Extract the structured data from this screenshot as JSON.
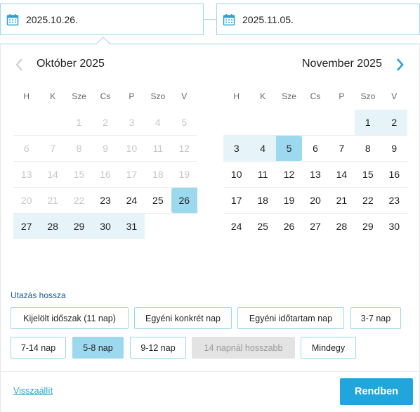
{
  "date_inputs": {
    "start": "2025.10.26.",
    "end": "2025.11.05."
  },
  "calendars": {
    "weekday_headers": [
      "H",
      "K",
      "Sze",
      "Cs",
      "P",
      "Szo",
      "V"
    ],
    "left": {
      "title": "Október 2025",
      "rows": [
        [
          "",
          "",
          "1",
          "2",
          "3",
          "4",
          "5"
        ],
        [
          "6",
          "7",
          "8",
          "9",
          "10",
          "11",
          "12"
        ],
        [
          "13",
          "14",
          "15",
          "16",
          "17",
          "18",
          "19"
        ],
        [
          "20",
          "21",
          "22",
          "23",
          "24",
          "25",
          "26"
        ],
        [
          "27",
          "28",
          "29",
          "30",
          "31",
          "",
          ""
        ]
      ]
    },
    "right": {
      "title": "November 2025",
      "rows": [
        [
          "",
          "",
          "",
          "",
          "",
          "1",
          "2"
        ],
        [
          "3",
          "4",
          "5",
          "6",
          "7",
          "8",
          "9"
        ],
        [
          "10",
          "11",
          "12",
          "13",
          "14",
          "15",
          "16"
        ],
        [
          "17",
          "18",
          "19",
          "20",
          "21",
          "22",
          "23"
        ],
        [
          "24",
          "25",
          "26",
          "27",
          "28",
          "29",
          "30"
        ]
      ]
    }
  },
  "duration": {
    "title": "Utazás hossza",
    "options": [
      "Kijelölt időszak (11 nap)",
      "Egyéni konkrét nap",
      "Egyéni időtartam nap",
      "3-7 nap",
      "7-14 nap",
      "5-8 nap",
      "9-12 nap",
      "14 napnál hosszabb",
      "Mindegy"
    ],
    "selected": "5-8 nap",
    "disabled": "14 napnál hosszabb"
  },
  "footer": {
    "reset_label": "Visszaállít",
    "ok_label": "Rendben"
  },
  "icons": {
    "date": "calendar-icon",
    "prev": "chevron-left-icon",
    "next": "chevron-right-icon"
  },
  "colors": {
    "accent": "#20a6dc",
    "range_edge": "#9dd9ee",
    "range_fill": "#e6f4fa",
    "border": "#9bd8ea",
    "link": "#2aa3d1",
    "section_title": "#1a5a96"
  }
}
